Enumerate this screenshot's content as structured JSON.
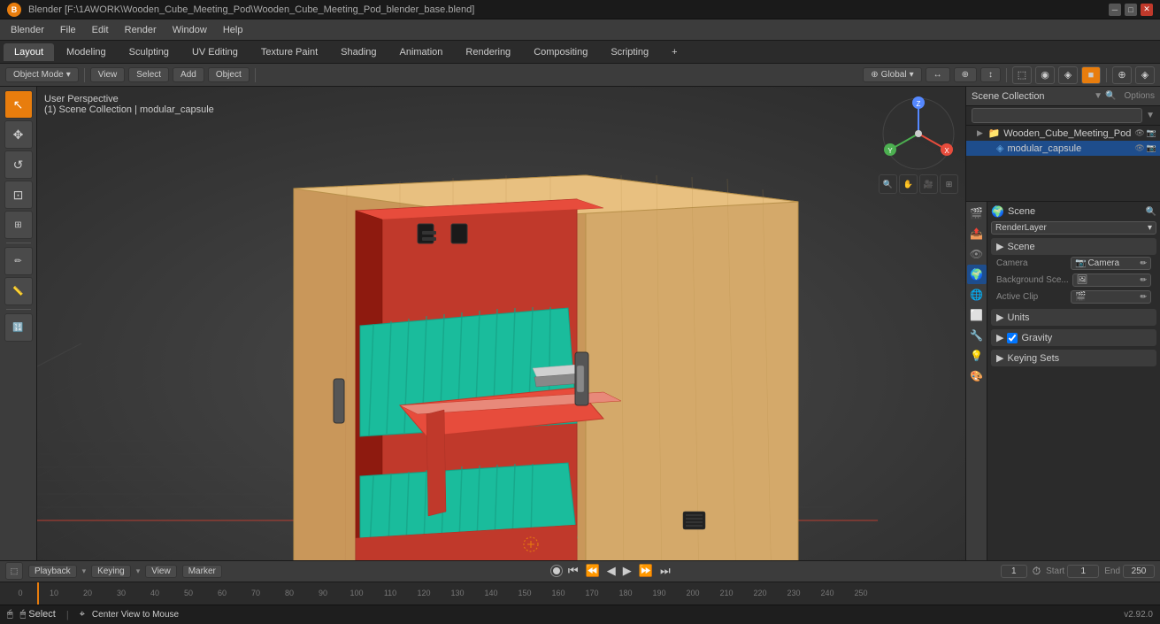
{
  "titleBar": {
    "title": "Blender [F:\\1AWORK\\Wooden_Cube_Meeting_Pod\\Wooden_Cube_Meeting_Pod_blender_base.blend]",
    "logoText": "B"
  },
  "menuBar": {
    "items": [
      "Blender",
      "File",
      "Edit",
      "Render",
      "Window",
      "Help"
    ]
  },
  "workspaceTabs": {
    "tabs": [
      "Layout",
      "Modeling",
      "Sculpting",
      "UV Editing",
      "Texture Paint",
      "Shading",
      "Animation",
      "Rendering",
      "Compositing",
      "Scripting"
    ],
    "activeTab": "Layout",
    "addBtn": "+"
  },
  "viewportToolbar": {
    "objectMode": "Object Mode",
    "viewMenu": "View",
    "selectMenu": "Select",
    "addMenu": "Add",
    "objectMenu": "Object",
    "globalBtn": "Global",
    "transformIcons": [
      "↔",
      "⊕",
      "↕"
    ],
    "shadingBtns": [
      "⬜",
      "◉",
      "◈",
      "■"
    ],
    "overlayBtn": "⊕",
    "gizmoBtn": "◈"
  },
  "viewport": {
    "infoLine1": "User Perspective",
    "infoLine2": "(1) Scene Collection | modular_capsule",
    "bgColor": "#404040"
  },
  "outliner": {
    "title": "Scene Collection",
    "searchPlaceholder": "",
    "items": [
      {
        "label": "Wooden_Cube_Meeting_Pod",
        "icon": "📁",
        "expanded": true,
        "level": 0
      },
      {
        "label": "modular_capsule",
        "icon": "🔷",
        "expanded": false,
        "level": 1,
        "selected": true
      }
    ]
  },
  "propertiesPanel": {
    "sections": [
      {
        "id": "scene",
        "title": "Scene",
        "rows": [
          {
            "label": "Camera",
            "value": "Camera",
            "icon": "📷"
          },
          {
            "label": "Background Sce...",
            "value": "",
            "icon": "🖼"
          },
          {
            "label": "Active Clip",
            "value": "",
            "icon": "🎬"
          }
        ]
      },
      {
        "id": "units",
        "title": "Units",
        "rows": []
      },
      {
        "id": "gravity",
        "title": "Gravity",
        "rows": [],
        "checkbox": true
      },
      {
        "id": "keying-sets",
        "title": "Keying Sets",
        "rows": []
      }
    ]
  },
  "propIcons": [
    "🎬",
    "🔳",
    "☀",
    "🌍",
    "🔧",
    "🔲",
    "💡",
    "🎨",
    "🔑"
  ],
  "timeline": {
    "playback": "Playback",
    "keying": "Keying",
    "view": "View",
    "marker": "Marker",
    "currentFrame": "1",
    "startFrame": "1",
    "endFrame": "250",
    "startLabel": "Start",
    "endLabel": "End",
    "frameNumbers": [
      "0",
      "10",
      "20",
      "30",
      "40",
      "50",
      "60",
      "70",
      "80",
      "90",
      "100",
      "110",
      "120",
      "130",
      "140",
      "150",
      "160",
      "170",
      "180",
      "190",
      "200",
      "210",
      "220",
      "230",
      "240",
      "250"
    ]
  },
  "statusBar": {
    "leftItems": [
      {
        "key": "🖱 Select",
        "label": ""
      },
      {
        "key": "⌖ Center View to Mouse",
        "label": ""
      }
    ],
    "rightText": "v2.92.0"
  },
  "tools": [
    {
      "icon": "↖",
      "name": "select-tool",
      "active": true
    },
    {
      "icon": "✥",
      "name": "move-tool"
    },
    {
      "icon": "↺",
      "name": "rotate-tool"
    },
    {
      "icon": "⊡",
      "name": "scale-tool"
    },
    {
      "icon": "⊞",
      "name": "transform-tool"
    },
    "sep",
    {
      "icon": "📐",
      "name": "annotate-tool"
    },
    {
      "icon": "📏",
      "name": "measure-tool"
    },
    "sep",
    {
      "icon": "🔢",
      "name": "extra-tool"
    }
  ],
  "navGizmo": {
    "xColor": "#e74c3c",
    "yColor": "#4caf50",
    "zColor": "#2196f3"
  },
  "optionsBtn": "Options",
  "renderLayerLabel": "RenderLayer",
  "sceneLabel": "Scene",
  "colors": {
    "accent": "#e87d0d",
    "selected": "#1e4d8c",
    "bg": "#2b2b2b",
    "panel": "#3c3c3c",
    "border": "#1a1a1a"
  }
}
